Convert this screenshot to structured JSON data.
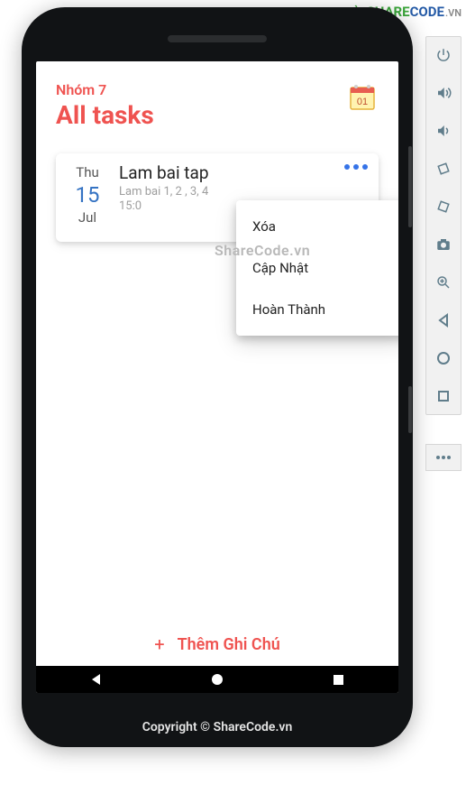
{
  "watermarks": {
    "logo_part1": "SHARE",
    "logo_part2": "CODE",
    "logo_suffix": ".VN",
    "center": "ShareCode.vn",
    "footer": "Copyright © ShareCode.vn"
  },
  "app": {
    "group_label": "Nhóm 7",
    "page_title": "All tasks",
    "calendar_day": "01",
    "task": {
      "dow": "Thu",
      "day": "15",
      "month": "Jul",
      "title": "Lam bai tap",
      "desc": "Lam bai 1, 2 , 3, 4",
      "time": "15:0"
    },
    "popup": {
      "items": [
        "Xóa",
        "Cập Nhật",
        "Hoàn Thành"
      ]
    },
    "add_button": {
      "plus": "+",
      "label": "Thêm Ghi Chú"
    }
  },
  "emulator_icons": [
    "power-icon",
    "volume-up-icon",
    "volume-down-icon",
    "rotate-left-icon",
    "rotate-right-icon",
    "camera-icon",
    "zoom-icon",
    "back-icon",
    "home-icon",
    "overview-icon"
  ]
}
